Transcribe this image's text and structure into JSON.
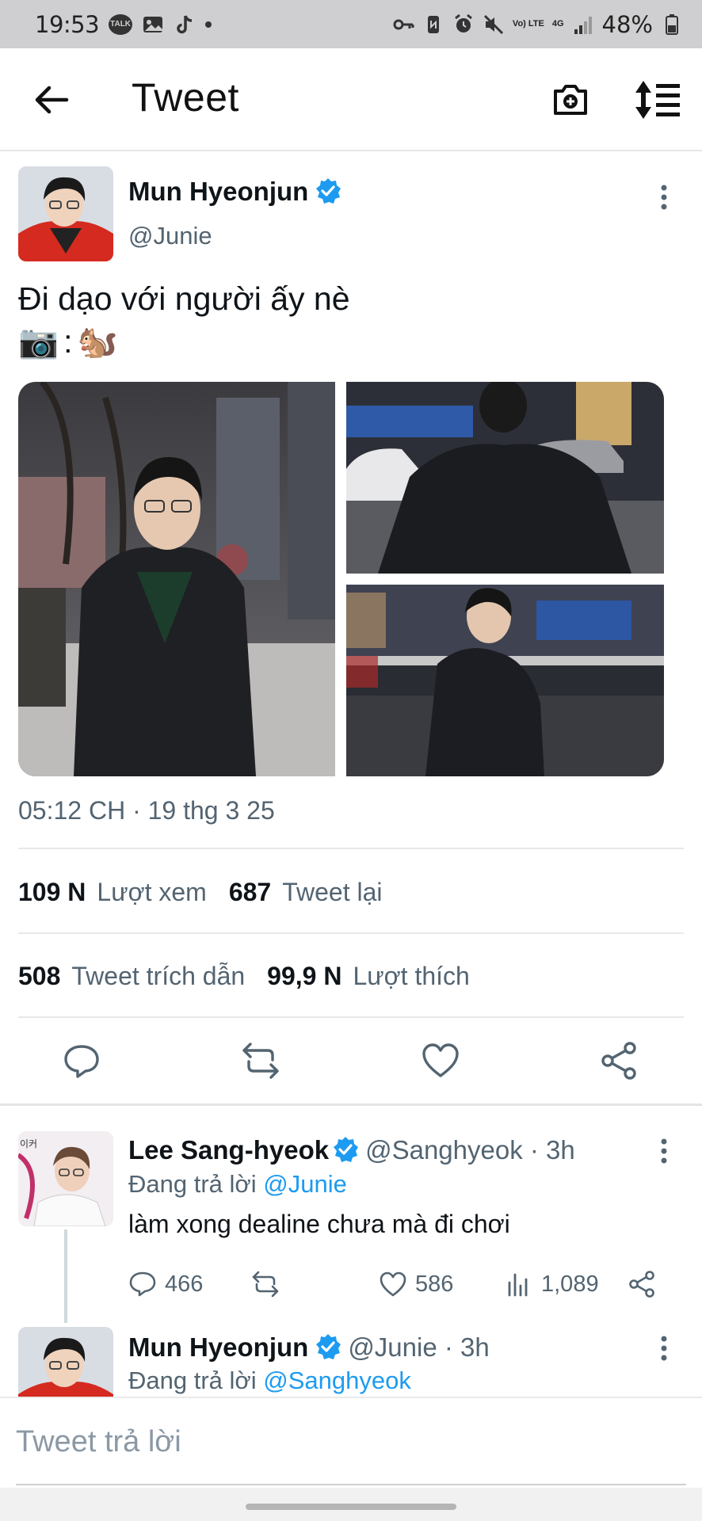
{
  "status_bar": {
    "time": "19:53",
    "talk_label": "TALK",
    "network_label_top": "Vo) LTE",
    "network_label_4g": "4G",
    "battery": "48%"
  },
  "header": {
    "title": "Tweet",
    "icons": [
      "back-arrow-icon",
      "camera-plus-icon",
      "sort-icon"
    ]
  },
  "tweet": {
    "author_name": "Mun Hyeonjun",
    "author_handle": "@Junie",
    "text_line1": "Đi dạo với người ấy nè",
    "text_line2_emoji_camera": "📷",
    "text_line2_colon": ":",
    "text_line2_emoji_squirrel": "🐿️",
    "timestamp": "05:12 CH · 19 thg 3 25",
    "stats": {
      "views_count": "109 N",
      "views_label": "Lượt xem",
      "retweets_count": "687",
      "retweets_label": "Tweet lại",
      "quotes_count": "508",
      "quotes_label": "Tweet trích dẫn",
      "likes_count": "99,9 N",
      "likes_label": "Lượt thích"
    },
    "photos": 3
  },
  "replies": [
    {
      "name": "Lee Sang-hyeok",
      "handle_time": "@Sanghyeok · 3h",
      "replying_prefix": "Đang trả lời",
      "replying_to": "@Junie",
      "text": "làm xong dealine chưa mà đi chơi",
      "replies_count": "466",
      "likes_count": "586",
      "views_count": "1,089",
      "avatar_caption": "이커"
    },
    {
      "name": "Mun Hyeonjun",
      "handle_time": "@Junie · 3h",
      "replying_prefix": "Đang trả lời",
      "replying_to": "@Sanghyeok"
    }
  ],
  "compose": {
    "placeholder": "Tweet trả lời"
  },
  "colors": {
    "accent": "#1d9bf0",
    "secondary_text": "#536471",
    "status_bar_bg": "#cfcfd1"
  }
}
